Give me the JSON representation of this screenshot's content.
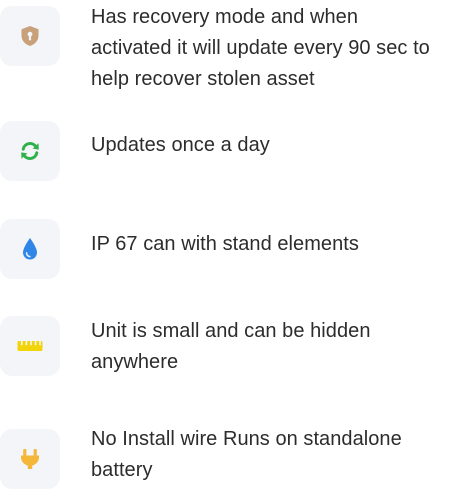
{
  "features": [
    {
      "icon": "shield-lock-icon",
      "color": "#c8a07a",
      "text": "Has recovery mode and when activated it will update every 90 sec to help recover stolen asset"
    },
    {
      "icon": "refresh-icon",
      "color": "#2fb24a",
      "text": "Updates once a day"
    },
    {
      "icon": "water-drop-icon",
      "color": "#2f86e6",
      "text": "IP 67 can with stand elements"
    },
    {
      "icon": "ruler-icon",
      "color": "#f2d40a",
      "text": "Unit is small and can be hidden anywhere"
    },
    {
      "icon": "plug-icon",
      "color": "#f5b73a",
      "text": "No Install wire Runs on standalone battery"
    }
  ]
}
